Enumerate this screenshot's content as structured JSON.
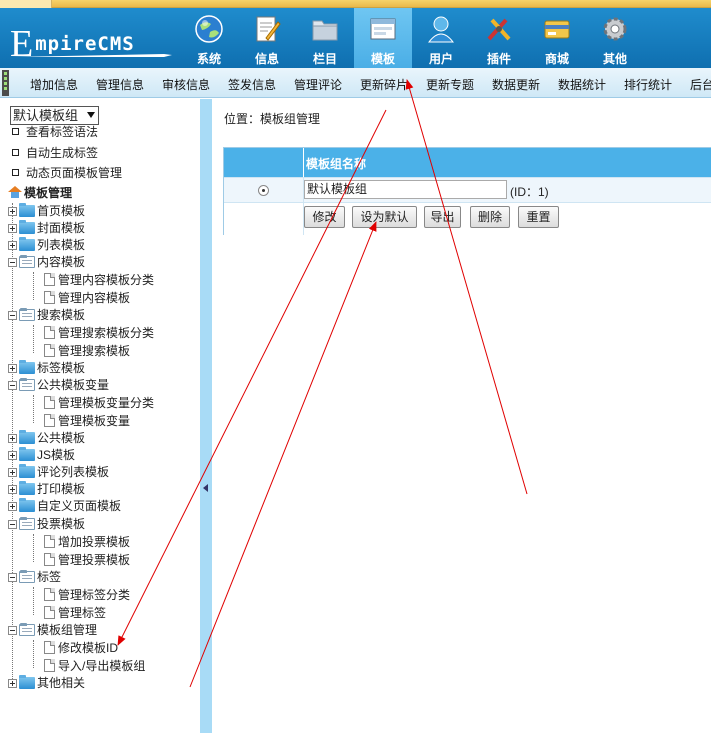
{
  "app": {
    "logo_letter": "E",
    "logo_rest": "mpireCMS"
  },
  "topnav": [
    {
      "label": "系统",
      "icon": "globe-icon"
    },
    {
      "label": "信息",
      "icon": "edit-document-icon"
    },
    {
      "label": "栏目",
      "icon": "folder-icon"
    },
    {
      "label": "模板",
      "icon": "template-window-icon",
      "active": true
    },
    {
      "label": "用户",
      "icon": "user-icon"
    },
    {
      "label": "插件",
      "icon": "tools-icon"
    },
    {
      "label": "商城",
      "icon": "shop-card-icon"
    },
    {
      "label": "其他",
      "icon": "gear-icon"
    }
  ],
  "subnav": [
    "增加信息",
    "管理信息",
    "审核信息",
    "签发信息",
    "管理评论",
    "更新碎片",
    "更新专题",
    "数据更新",
    "数据统计",
    "排行统计",
    "后台"
  ],
  "sidebar": {
    "template_group_select": "默认模板组",
    "top_links": [
      "查看标签语法",
      "自动生成标签",
      "动态页面模板管理"
    ],
    "root": "模板管理",
    "tree": [
      "首页模板",
      "封面模板",
      "列表模板",
      "内容模板",
      "管理内容模板分类",
      "管理内容模板",
      "搜索模板",
      "管理搜索模板分类",
      "管理搜索模板",
      "标签模板",
      "公共模板变量",
      "管理模板变量分类",
      "管理模板变量",
      "公共模板",
      "JS模板",
      "评论列表模板",
      "打印模板",
      "自定义页面模板",
      "投票模板",
      "增加投票模板",
      "管理投票模板",
      "标签",
      "管理标签分类",
      "管理标签",
      "模板组管理",
      "修改模板ID",
      "导入/导出模板组",
      "其他相关"
    ]
  },
  "main": {
    "breadcrumb_prefix": "位置：",
    "breadcrumb_link": "模板组管理",
    "table_header": "模板组名称",
    "group_name": "默认模板组",
    "group_id_text": "(ID：1)",
    "buttons": [
      "修改",
      "设为默认",
      "导出",
      "删除",
      "重置"
    ]
  },
  "colors": {
    "header_blue": "#1a83c5",
    "active_tab": "#5bbaee",
    "table_header": "#4bb1e8",
    "annotation": "#e00000"
  }
}
